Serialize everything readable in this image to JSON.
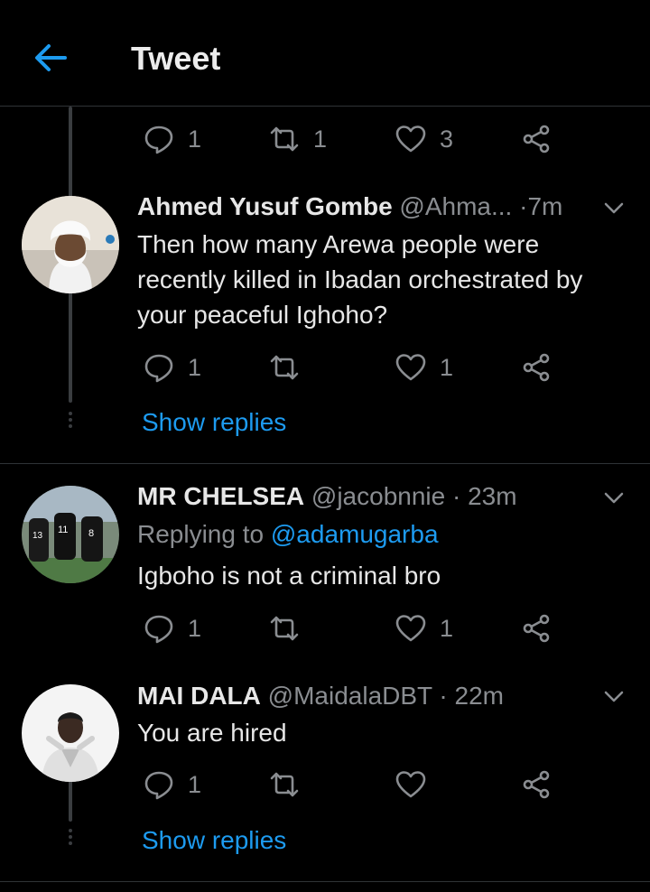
{
  "header": {
    "title": "Tweet",
    "back_icon": "arrow-left-icon"
  },
  "colors": {
    "accent": "#1d9bf0",
    "background": "#000000",
    "muted": "#8a8d91"
  },
  "top_actions": {
    "reply_count": "1",
    "retweet_count": "1",
    "like_count": "3"
  },
  "tweets": [
    {
      "name": "Ahmed Yusuf Gombe",
      "handle": "@Ahma...",
      "dot": "·",
      "time": "7m",
      "text": "Then how many Arewa people were recently killed in Ibadan orchestrated by your peaceful Ighoho?",
      "reply_count": "1",
      "retweet_count": "",
      "like_count": "1",
      "show_replies": "Show replies"
    },
    {
      "name": "MR CHELSEA",
      "handle": "@jacobnnie",
      "dot": "·",
      "time": "23m",
      "replying_prefix": "Replying to",
      "replying_handle": "@adamugarba",
      "text": "Igboho is not a criminal bro",
      "reply_count": "1",
      "retweet_count": "",
      "like_count": "1"
    },
    {
      "name": "MAI DALA",
      "handle": "@MaidalaDBT",
      "dot": "·",
      "time": "22m",
      "text": "You are hired",
      "reply_count": "1",
      "retweet_count": "",
      "like_count": "",
      "show_replies": "Show replies"
    }
  ]
}
